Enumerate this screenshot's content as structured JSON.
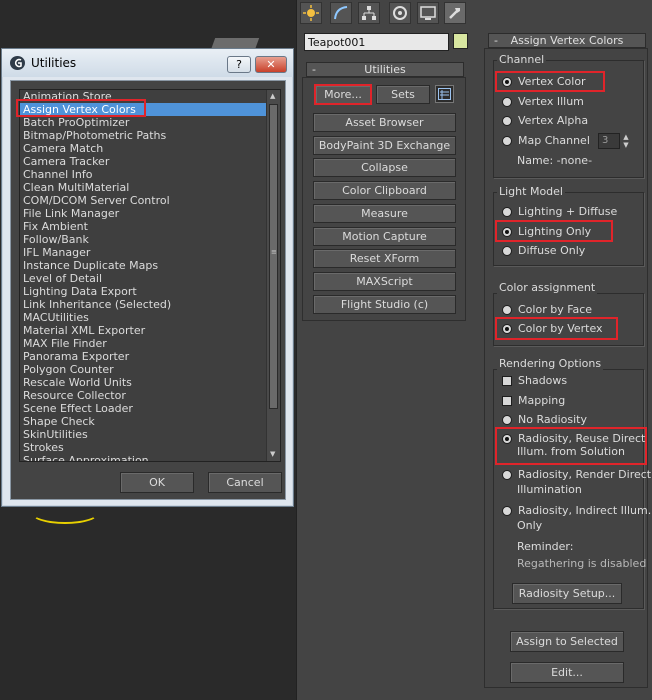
{
  "command_panel": {
    "object_name": "Teapot001",
    "object_color": "#d8e6a0",
    "tabs": [
      "create-icon",
      "modify-icon",
      "hierarchy-icon",
      "motion-icon",
      "display-icon",
      "utilities-icon"
    ]
  },
  "utilities_rollout": {
    "title": "Utilities",
    "more_label": "More...",
    "sets_label": "Sets",
    "buttons": [
      "Asset Browser",
      "BodyPaint 3D Exchange",
      "Collapse",
      "Color Clipboard",
      "Measure",
      "Motion Capture",
      "Reset XForm",
      "MAXScript",
      "Flight Studio (c)"
    ]
  },
  "assign_rollout": {
    "title": "Assign Vertex Colors",
    "channel": {
      "label": "Channel",
      "options": [
        "Vertex Color",
        "Vertex Illum",
        "Vertex Alpha",
        "Map Channel"
      ],
      "selected": "Vertex Color",
      "map_channel_value": "3",
      "name_text": "Name: -none-"
    },
    "light_model": {
      "label": "Light Model",
      "options": [
        "Lighting + Diffuse",
        "Lighting Only",
        "Diffuse Only"
      ],
      "selected": "Lighting Only"
    },
    "color_assignment": {
      "label": "Color assignment",
      "options": [
        "Color by Face",
        "Color by Vertex"
      ],
      "selected": "Color by Vertex"
    },
    "rendering": {
      "label": "Rendering Options",
      "shadows": "Shadows",
      "mapping": "Mapping",
      "no_radiosity": "No Radiosity",
      "reuse_line1": "Radiosity, Reuse Direct",
      "reuse_line2": "Illum. from Solution",
      "render_line1": "Radiosity, Render Direct",
      "render_line2": "Illumination",
      "indirect_line1": "Radiosity, Indirect Illum.",
      "indirect_line2": "Only",
      "reminder_label": "Reminder:",
      "reminder_text": "Regathering is disabled",
      "setup_label": "Radiosity Setup..."
    },
    "assign_label": "Assign to Selected",
    "edit_label": "Edit..."
  },
  "dialog": {
    "title": "Utilities",
    "help_label": "?",
    "close_label": "✕",
    "items": [
      "Animation Store",
      "Assign Vertex Colors",
      "Batch ProOptimizer",
      "Bitmap/Photometric Paths",
      "Camera Match",
      "Camera Tracker",
      "Channel Info",
      "Clean MultiMaterial",
      "COM/DCOM Server Control",
      "File Link Manager",
      "Fix Ambient",
      "Follow/Bank",
      "IFL Manager",
      "Instance Duplicate Maps",
      "Level of Detail",
      "Lighting Data Export",
      "Link Inheritance (Selected)",
      "MACUtilities",
      "Material XML Exporter",
      "MAX File Finder",
      "Panorama Exporter",
      "Polygon Counter",
      "Rescale World Units",
      "Resource Collector",
      "Scene Effect Loader",
      "Shape Check",
      "SkinUtilities",
      "Strokes",
      "Surface Approximation"
    ],
    "selected": "Assign Vertex Colors",
    "ok_label": "OK",
    "cancel_label": "Cancel"
  }
}
